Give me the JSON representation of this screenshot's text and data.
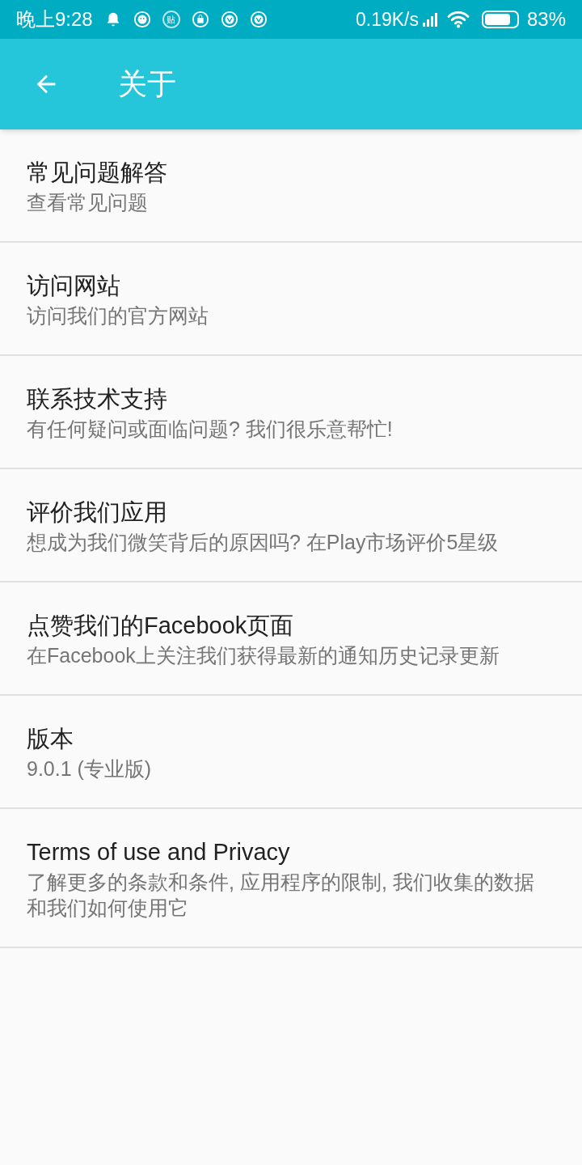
{
  "status_bar": {
    "time": "晚上9:28",
    "notifications": [
      {
        "kind": "bell"
      },
      {
        "kind": "smiley"
      },
      {
        "kind": "text",
        "label": "贴"
      },
      {
        "kind": "bag"
      },
      {
        "kind": "browser"
      },
      {
        "kind": "browser"
      }
    ],
    "speed": "0.19K/s",
    "battery": "83%"
  },
  "app_bar": {
    "title": "关于"
  },
  "items": [
    {
      "title": "常见问题解答",
      "subtitle": "查看常见问题"
    },
    {
      "title": "访问网站",
      "subtitle": "访问我们的官方网站"
    },
    {
      "title": "联系技术支持",
      "subtitle": "有任何疑问或面临问题? 我们很乐意帮忙!"
    },
    {
      "title": "评价我们应用",
      "subtitle": "想成为我们微笑背后的原因吗? 在Play市场评价5星级"
    },
    {
      "title": "点赞我们的Facebook页面",
      "subtitle": "在Facebook上关注我们获得最新的通知历史记录更新"
    },
    {
      "title": "版本",
      "subtitle": "9.0.1 (专业版)"
    },
    {
      "title": "Terms of use and Privacy",
      "subtitle": "了解更多的条款和条件, 应用程序的限制, 我们收集的数据和我们如何使用它"
    }
  ]
}
